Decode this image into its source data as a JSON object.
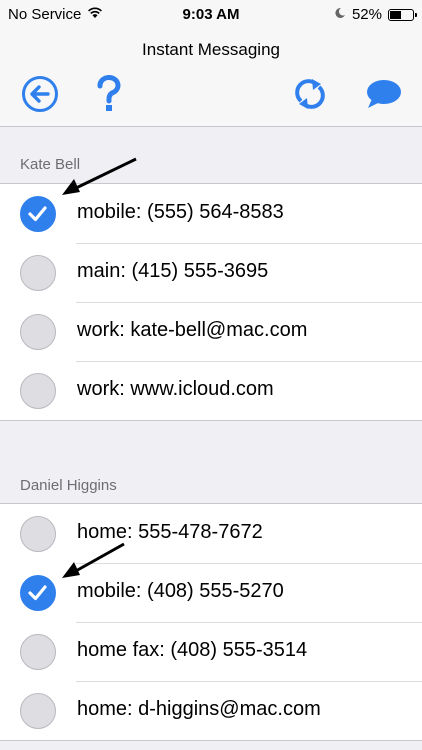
{
  "status_bar": {
    "carrier": "No Service",
    "time": "9:03 AM",
    "battery_percent": "52%",
    "battery_level": 0.52
  },
  "nav": {
    "title": "Instant Messaging",
    "icons": [
      "back-arrow-icon",
      "help-icon",
      "refresh-icon",
      "message-bubble-icon"
    ]
  },
  "colors": {
    "accent": "#2f80ed",
    "background": "#efeff4",
    "header_text": "#6d6d72"
  },
  "contacts": [
    {
      "name": "Kate Bell",
      "entries": [
        {
          "label": "mobile: (555) 564-8583",
          "checked": true
        },
        {
          "label": "main: (415) 555-3695",
          "checked": false
        },
        {
          "label": "work: kate-bell@mac.com",
          "checked": false
        },
        {
          "label": "work: www.icloud.com",
          "checked": false
        }
      ]
    },
    {
      "name": "Daniel Higgins",
      "entries": [
        {
          "label": "home: 555-478-7672",
          "checked": false
        },
        {
          "label": "mobile: (408) 555-5270",
          "checked": true
        },
        {
          "label": "home fax: (408) 555-3514",
          "checked": false
        },
        {
          "label": "home: d-higgins@mac.com",
          "checked": false
        }
      ]
    }
  ]
}
